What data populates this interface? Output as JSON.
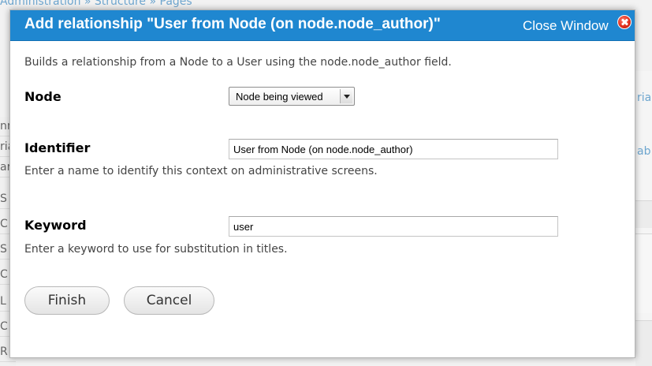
{
  "background": {
    "breadcrumb": "Administration » Structure » Pages",
    "left_fragments": [
      "nn",
      "ria",
      "ar",
      "S",
      "C",
      "S",
      "C",
      "L",
      "C",
      "R"
    ],
    "right_fragments": [
      "ria",
      "ab"
    ]
  },
  "modal": {
    "title": "Add relationship \"User from Node (on node.node_author)\"",
    "close_label": "Close Window",
    "close_icon": "close-icon",
    "description": "Builds a relationship from a Node to a User using the node.node_author field.",
    "header_color": "#1f87d0",
    "fields": {
      "node": {
        "label": "Node",
        "selected_value": "Node being viewed"
      },
      "identifier": {
        "label": "Identifier",
        "value": "User from Node (on node.node_author)",
        "help": "Enter a name to identify this context on administrative screens."
      },
      "keyword": {
        "label": "Keyword",
        "value": "user",
        "help": "Enter a keyword to use for substitution in titles."
      }
    },
    "buttons": {
      "finish": "Finish",
      "cancel": "Cancel"
    }
  }
}
